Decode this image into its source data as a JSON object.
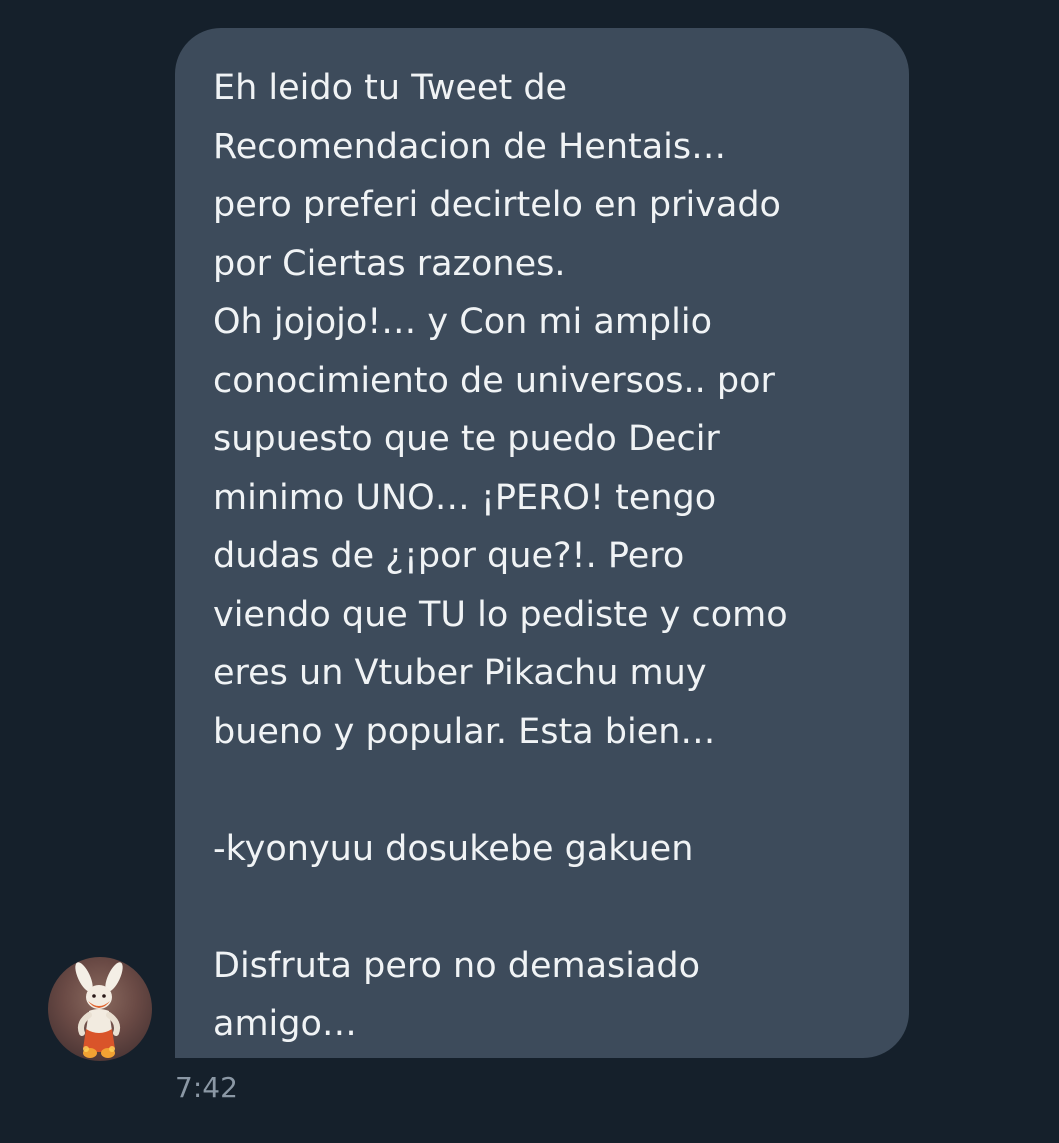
{
  "message": {
    "lines": [
      "Eh leido tu Tweet de",
      "Recomendacion de Hentais…",
      "pero preferi decirtelo en privado",
      "por Ciertas razones.",
      "Oh jojojo!… y Con mi amplio",
      "conocimiento de universos.. por",
      "supuesto que te puedo Decir",
      "minimo UNO… ¡PERO! tengo",
      "dudas de ¿¡por que?!. Pero",
      "viendo que TU lo pediste y como",
      "eres un Vtuber Pikachu muy",
      "bueno y popular. Esta bien…",
      "",
      "-kyonyuu dosukebe gakuen",
      "",
      "Disfruta pero no demasiado",
      "amigo…"
    ],
    "timestamp": "7:42"
  },
  "sender": {
    "avatar_icon": "fire-rabbit-avatar-icon"
  },
  "colors": {
    "background": "#15202b",
    "bubble": "#3d4b5b",
    "text": "#f0f3f5",
    "timestamp": "#8b98a5"
  }
}
